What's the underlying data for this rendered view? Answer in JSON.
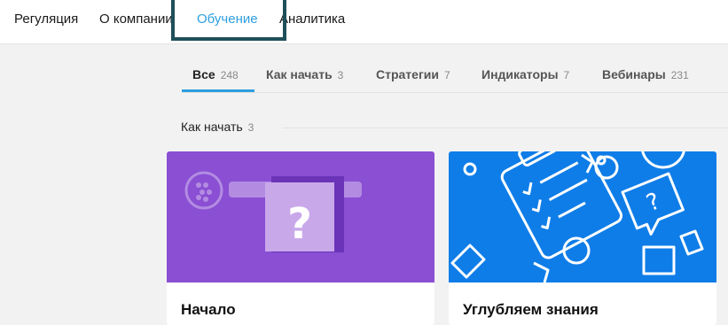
{
  "topnav": {
    "items": [
      {
        "label": "Регуляция",
        "active": false
      },
      {
        "label": "О компании",
        "active": false
      },
      {
        "label": "Обучение",
        "active": true
      },
      {
        "label": "Аналитика",
        "active": false
      }
    ]
  },
  "tabs": [
    {
      "label": "Все",
      "count": "248",
      "active": true
    },
    {
      "label": "Как начать",
      "count": "3",
      "active": false
    },
    {
      "label": "Стратегии",
      "count": "7",
      "active": false
    },
    {
      "label": "Индикаторы",
      "count": "7",
      "active": false
    },
    {
      "label": "Вебинары",
      "count": "231",
      "active": false
    }
  ],
  "section": {
    "title": "Как начать",
    "count": "3"
  },
  "cards": [
    {
      "title": "Начало",
      "image_icon": "question-icon",
      "image_color": "#8a4fd3"
    },
    {
      "title": "Углубляем знания",
      "image_icon": "clipboard-pattern-icon",
      "image_color": "#0f7de8"
    }
  ],
  "colors": {
    "accent": "#2e9fe0",
    "focus_outline": "#1f4f5a"
  }
}
